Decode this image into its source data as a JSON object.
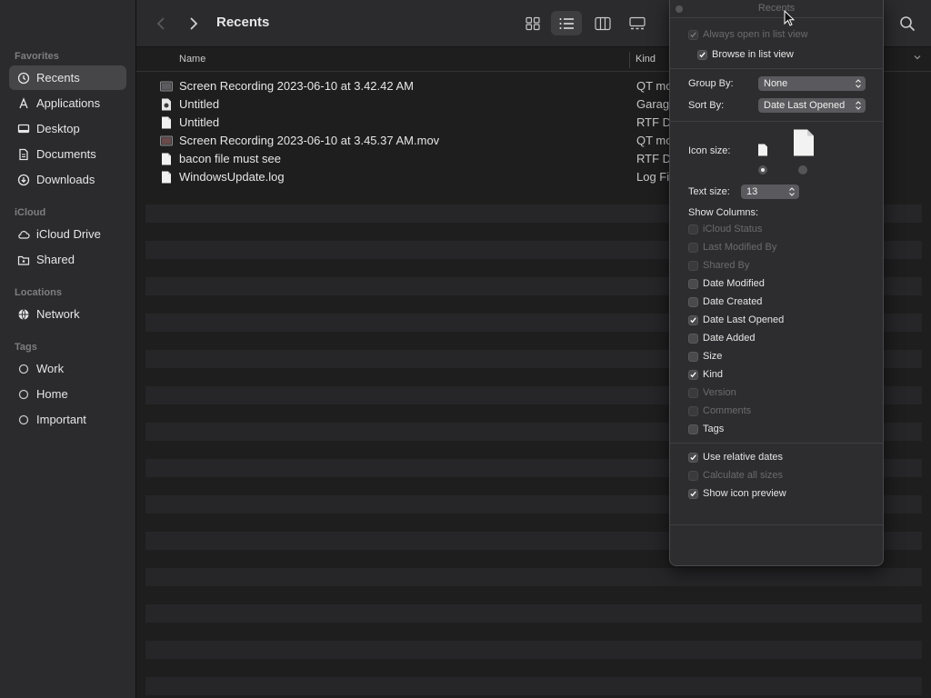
{
  "window": {
    "title": "Recents"
  },
  "sidebar": {
    "sections": [
      {
        "label": "Favorites"
      },
      {
        "label": "iCloud"
      },
      {
        "label": "Locations"
      },
      {
        "label": "Tags"
      }
    ],
    "favorites": [
      {
        "label": "Recents",
        "icon": "clock-icon",
        "active": true
      },
      {
        "label": "Applications",
        "icon": "applications-icon"
      },
      {
        "label": "Desktop",
        "icon": "desktop-icon"
      },
      {
        "label": "Documents",
        "icon": "document-icon"
      },
      {
        "label": "Downloads",
        "icon": "download-icon"
      }
    ],
    "icloud": [
      {
        "label": "iCloud Drive",
        "icon": "cloud-icon"
      },
      {
        "label": "Shared",
        "icon": "shared-folder-icon"
      }
    ],
    "locations": [
      {
        "label": "Network",
        "icon": "globe-icon"
      }
    ],
    "tags": [
      {
        "label": "Work",
        "icon": "tag-circle-icon"
      },
      {
        "label": "Home",
        "icon": "tag-circle-icon"
      },
      {
        "label": "Important",
        "icon": "tag-circle-icon"
      }
    ]
  },
  "columns": {
    "name": "Name",
    "kind": "Kind"
  },
  "files": [
    {
      "name": "Screen Recording 2023-06-10 at 3.42.42 AM",
      "kind": "QT mo",
      "icon": "video-file-icon"
    },
    {
      "name": "Untitled",
      "kind": "Garag",
      "icon": "garageband-file-icon"
    },
    {
      "name": "Untitled",
      "kind": "RTF D",
      "icon": "document-file-icon"
    },
    {
      "name": "Screen Recording 2023-06-10 at 3.45.37 AM.mov",
      "kind": "QT mo",
      "icon": "video-file-icon"
    },
    {
      "name": "bacon file must see",
      "kind": "RTF D",
      "icon": "document-file-icon"
    },
    {
      "name": "WindowsUpdate.log",
      "kind": "Log Fi",
      "icon": "document-file-icon"
    }
  ],
  "view_options": {
    "title": "Recents",
    "always_open_list": {
      "label": "Always open in list view",
      "checked": true,
      "enabled": false
    },
    "browse_list": {
      "label": "Browse in list view",
      "checked": true
    },
    "group_by": {
      "label": "Group By:",
      "value": "None"
    },
    "sort_by": {
      "label": "Sort By:",
      "value": "Date Last Opened"
    },
    "icon_size": {
      "label": "Icon size:",
      "selected": "small"
    },
    "text_size": {
      "label": "Text size:",
      "value": "13"
    },
    "show_columns_label": "Show Columns:",
    "columns": [
      {
        "label": "iCloud Status",
        "checked": false,
        "enabled": false
      },
      {
        "label": "Last Modified By",
        "checked": false,
        "enabled": false
      },
      {
        "label": "Shared By",
        "checked": false,
        "enabled": false
      },
      {
        "label": "Date Modified",
        "checked": false,
        "enabled": true
      },
      {
        "label": "Date Created",
        "checked": false,
        "enabled": true
      },
      {
        "label": "Date Last Opened",
        "checked": true,
        "enabled": true
      },
      {
        "label": "Date Added",
        "checked": false,
        "enabled": true
      },
      {
        "label": "Size",
        "checked": false,
        "enabled": true
      },
      {
        "label": "Kind",
        "checked": true,
        "enabled": true
      },
      {
        "label": "Version",
        "checked": false,
        "enabled": false
      },
      {
        "label": "Comments",
        "checked": false,
        "enabled": false
      },
      {
        "label": "Tags",
        "checked": false,
        "enabled": true
      }
    ],
    "relative_dates": {
      "label": "Use relative dates",
      "checked": true,
      "enabled": true
    },
    "calc_sizes": {
      "label": "Calculate all sizes",
      "checked": false,
      "enabled": false
    },
    "icon_preview": {
      "label": "Show icon preview",
      "checked": true,
      "enabled": true
    }
  }
}
